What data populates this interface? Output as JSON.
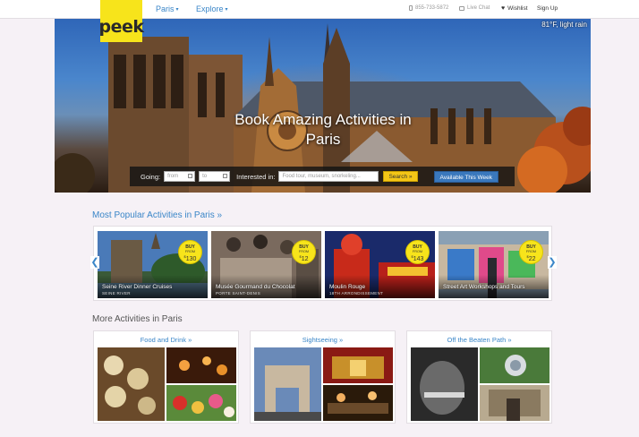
{
  "header": {
    "logo": "peek",
    "nav": [
      {
        "label": "Paris"
      },
      {
        "label": "Explore"
      }
    ],
    "phone": "855-733-5872",
    "live_chat": "Live Chat",
    "wishlist": "Wishlist",
    "signup": "Sign Up"
  },
  "hero": {
    "weather": "81°F, light rain",
    "headline_line1": "Book Amazing Activities in",
    "headline_line2": "Paris",
    "search": {
      "going_label": "Going:",
      "from_placeholder": "from",
      "to_placeholder": "to",
      "interested_label": "Interested in:",
      "interest_placeholder": "Food tour, museum, snorkeling...",
      "search_button": "Search »",
      "week_button": "Available This Week"
    }
  },
  "popular": {
    "title": "Most Popular Activities in Paris »",
    "items": [
      {
        "name": "Seine River Dinner Cruises",
        "sub": "SEINE RIVER",
        "buy": "BUY",
        "from": "FROM",
        "price_symbol": "$",
        "price": "130"
      },
      {
        "name": "Musée Gourmand du Chocolat",
        "sub": "PORTE SAINT-DENIS",
        "buy": "BUY",
        "from": "FROM",
        "price_symbol": "$",
        "price": "12"
      },
      {
        "name": "Moulin Rouge",
        "sub": "18TH ARRONDISSEMENT",
        "buy": "BUY",
        "from": "FROM",
        "price_symbol": "$",
        "price": "143"
      },
      {
        "name": "Street Art Workshops and Tours",
        "sub": "",
        "buy": "BUY",
        "from": "FROM",
        "price_symbol": "$",
        "price": "22"
      }
    ]
  },
  "more": {
    "title": "More Activities in Paris",
    "categories": [
      {
        "label": "Food and Drink »"
      },
      {
        "label": "Sightseeing »"
      },
      {
        "label": "Off the Beaten Path »"
      }
    ]
  },
  "icons": {
    "left_arrow": "❮",
    "right_arrow": "❯",
    "caret": "▾",
    "heart": "♥"
  }
}
